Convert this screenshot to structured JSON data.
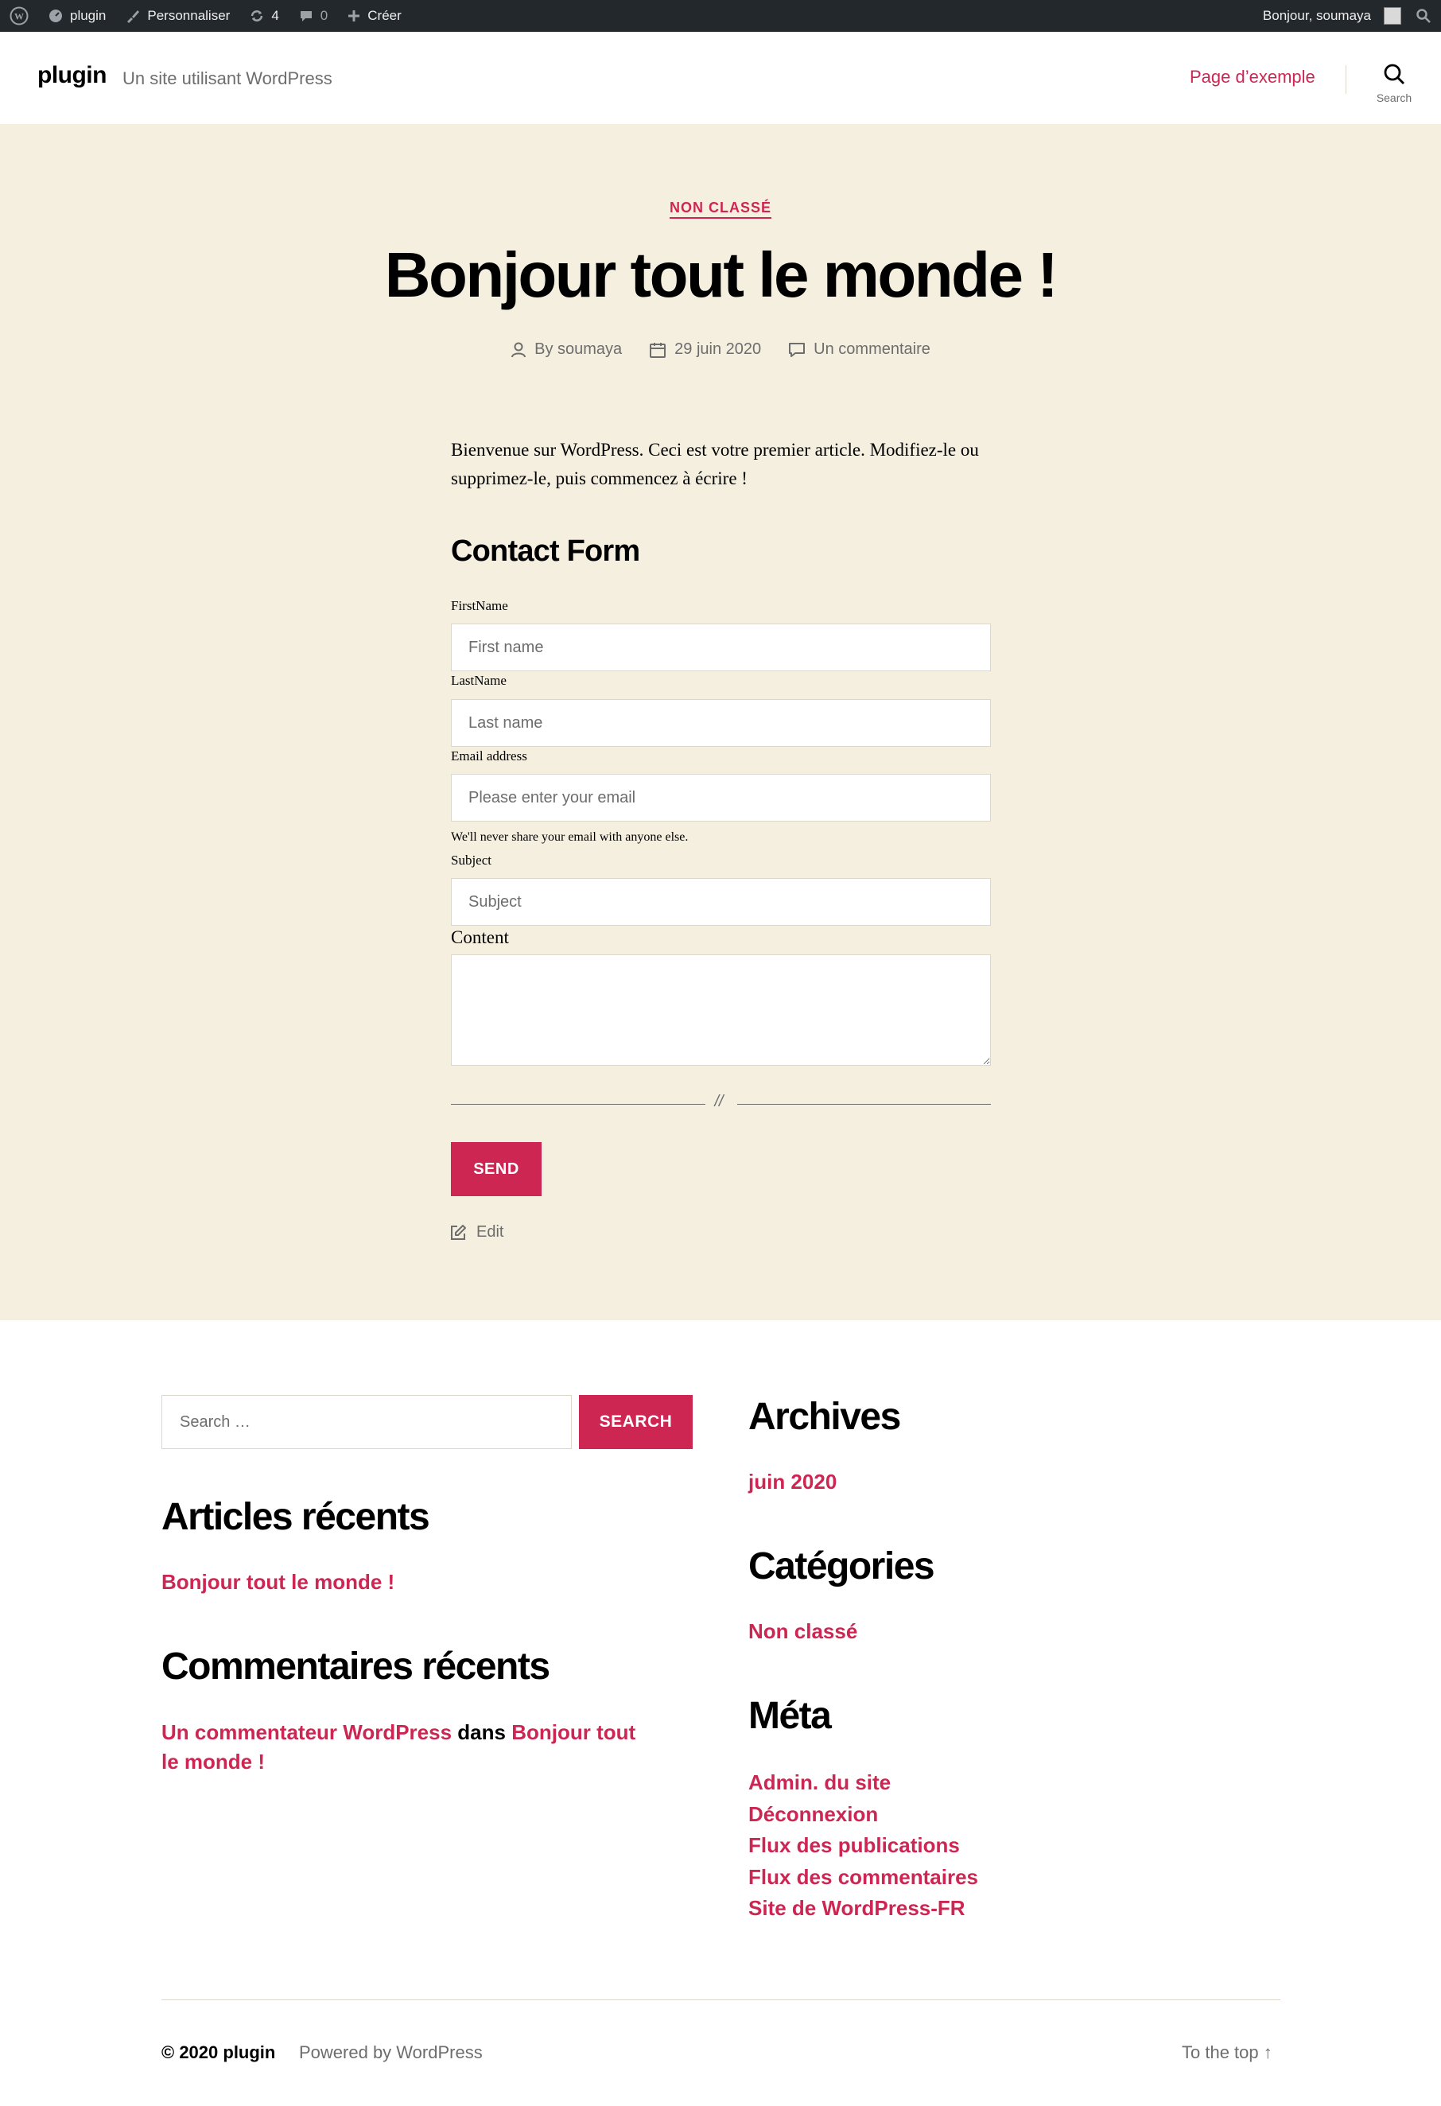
{
  "adminbar": {
    "site": "plugin",
    "customize": "Personnaliser",
    "updates_count": "4",
    "comments_count": "0",
    "create": "Créer",
    "greeting": "Bonjour, soumaya"
  },
  "header": {
    "site_title": "plugin",
    "tagline": "Un site utilisant WordPress",
    "nav_link": "Page d’exemple",
    "search_label": "Search"
  },
  "post": {
    "category": "NON CLASSÉ",
    "title": "Bonjour tout le monde !",
    "author": "By soumaya",
    "date": "29 juin 2020",
    "comments": "Un commentaire",
    "intro": "Bienvenue sur WordPress. Ceci est votre premier article. Modifiez-le ou supprimez-le, puis commencez à écrire !",
    "edit": "Edit"
  },
  "form": {
    "heading": "Contact Form",
    "firstname_label": "FirstName",
    "firstname_placeholder": "First name",
    "lastname_label": "LastName",
    "lastname_placeholder": "Last name",
    "email_label": "Email address",
    "email_placeholder": "Please enter your email",
    "email_help": "We'll never share your email with anyone else.",
    "subject_label": "Subject",
    "subject_placeholder": "Subject",
    "content_label": "Content",
    "separator_mark": "//",
    "send": "SEND"
  },
  "widgets": {
    "search_placeholder": "Search …",
    "search_button": "SEARCH",
    "recent_posts_title": "Articles récents",
    "recent_posts": [
      "Bonjour tout le monde !"
    ],
    "recent_comments_title": "Commentaires récents",
    "recent_comment": {
      "author": "Un commentateur WordPress",
      "connector": "dans",
      "post": "Bonjour tout le monde !"
    },
    "archives_title": "Archives",
    "archives": [
      "juin 2020"
    ],
    "categories_title": "Catégories",
    "categories": [
      "Non classé"
    ],
    "meta_title": "Méta",
    "meta_links": [
      "Admin. du site",
      "Déconnexion",
      "Flux des publications",
      "Flux des commentaires",
      "Site de WordPress-FR"
    ]
  },
  "footer": {
    "copyright": "© 2020 plugin",
    "powered": "Powered by WordPress",
    "to_top": "To the top ↑"
  },
  "colors": {
    "accent": "#cd2653",
    "beige": "#f5efe0",
    "adminbar": "#23282d",
    "muted": "#6d6d6d"
  }
}
